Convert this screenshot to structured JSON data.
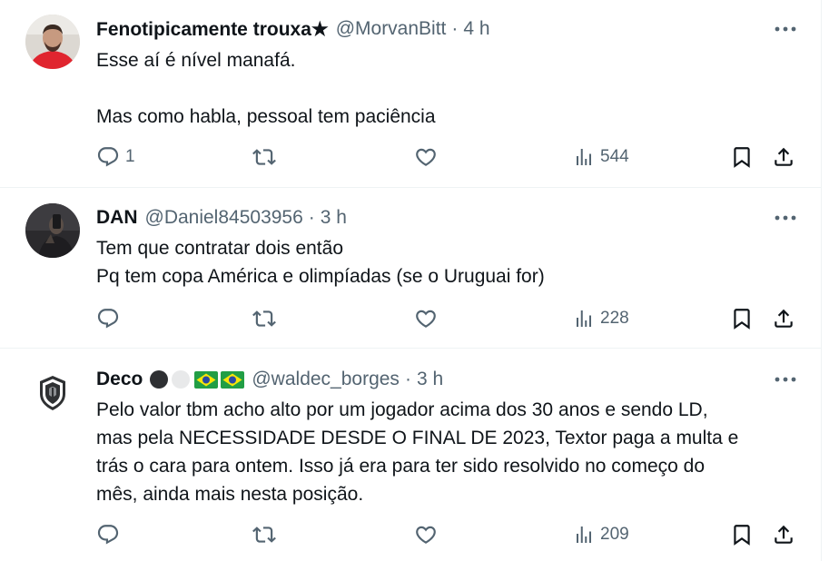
{
  "tweets": [
    {
      "name": "Fenotipicamente trouxa★",
      "handle": "@MorvanBitt",
      "separator": "·",
      "time": "4 h",
      "lines": [
        "Esse aí é nível manafá.",
        "",
        "Mas como habla, pessoal tem paciência"
      ],
      "replies": "1",
      "retweets": "",
      "likes": "",
      "views": "544"
    },
    {
      "name": "DAN",
      "handle": "@Daniel84503956",
      "separator": "·",
      "time": "3 h",
      "lines": [
        "Tem que contratar dois então",
        "Pq tem copa América e olimpíadas (se o Uruguai for)"
      ],
      "replies": "",
      "retweets": "",
      "likes": "",
      "views": "228"
    },
    {
      "name": "Deco",
      "handle": "@waldec_borges",
      "separator": "·",
      "time": "3 h",
      "lines": [
        "Pelo valor tbm acho alto por um jogador acima dos 30 anos e sendo LD,",
        "mas pela NECESSIDADE DESDE O FINAL DE 2023, Textor paga a multa e",
        "trás o cara para ontem. Isso já era para ter sido resolvido no começo do",
        "mês, ainda mais nesta posição."
      ],
      "replies": "",
      "retweets": "",
      "likes": "",
      "views": "209"
    }
  ],
  "icons": {
    "more": "more-options-icon",
    "reply": "reply-icon",
    "retweet": "retweet-icon",
    "like": "like-icon",
    "views": "views-icon",
    "bookmark": "bookmark-icon",
    "share": "share-icon"
  },
  "colors": {
    "text": "#0f1419",
    "secondary": "#536471",
    "divider": "#eff3f4",
    "brazil_green": "#229e45",
    "brazil_yellow": "#f8e509",
    "brazil_blue": "#2b49a3"
  }
}
